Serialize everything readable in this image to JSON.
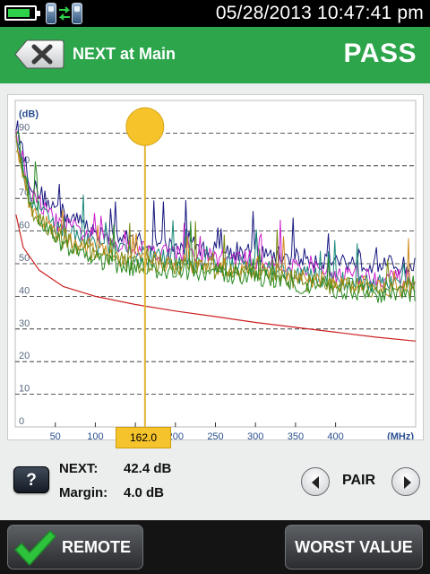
{
  "status_bar": {
    "datetime": "05/28/2013 10:47:41 pm",
    "icons": [
      "battery-icon",
      "tester-device-icon",
      "link-arrows-icon",
      "remote-device-icon"
    ],
    "battery_level": 0.85
  },
  "header": {
    "title": "NEXT at Main",
    "result": "PASS",
    "back_icon": "close-x-icon",
    "background_color": "#2ca54b"
  },
  "chart_data": {
    "type": "line",
    "xlabel": "(MHz)",
    "ylabel": "(dB)",
    "xlim": [
      0,
      500
    ],
    "ylim": [
      0,
      100
    ],
    "x_ticks": [
      "50",
      "100",
      "150",
      "200",
      "250",
      "300",
      "350",
      "400"
    ],
    "y_ticks": [
      "0",
      "10",
      "20",
      "30",
      "40",
      "50",
      "60",
      "70",
      "80",
      "90"
    ],
    "grid": true,
    "cursor_x": 162.0,
    "limit_line": {
      "color": "#cc2020",
      "points": [
        [
          1,
          65
        ],
        [
          10,
          55
        ],
        [
          30,
          48
        ],
        [
          60,
          43
        ],
        [
          100,
          40
        ],
        [
          150,
          37.5
        ],
        [
          200,
          35.5
        ],
        [
          250,
          33.8
        ],
        [
          300,
          32
        ],
        [
          350,
          30.5
        ],
        [
          400,
          29
        ],
        [
          450,
          27.5
        ],
        [
          500,
          26.3
        ]
      ]
    },
    "series": [
      {
        "color": "#1a1a80",
        "base": [
          [
            1,
            93
          ],
          [
            20,
            74
          ],
          [
            50,
            67
          ],
          [
            100,
            60
          ],
          [
            150,
            57
          ],
          [
            200,
            55
          ],
          [
            250,
            54
          ],
          [
            300,
            53
          ],
          [
            350,
            52
          ],
          [
            400,
            51
          ],
          [
            500,
            49
          ]
        ]
      },
      {
        "color": "#cc22cc",
        "base": [
          [
            1,
            90
          ],
          [
            20,
            71
          ],
          [
            50,
            63
          ],
          [
            100,
            58
          ],
          [
            150,
            55
          ],
          [
            200,
            53
          ],
          [
            250,
            52
          ],
          [
            300,
            51
          ],
          [
            350,
            49
          ],
          [
            400,
            47
          ],
          [
            500,
            45
          ]
        ]
      },
      {
        "color": "#1a8a7a",
        "base": [
          [
            1,
            88
          ],
          [
            20,
            69
          ],
          [
            50,
            61
          ],
          [
            100,
            56
          ],
          [
            150,
            53
          ],
          [
            200,
            51
          ],
          [
            250,
            50
          ],
          [
            300,
            49
          ],
          [
            350,
            47
          ],
          [
            400,
            45
          ],
          [
            500,
            43
          ]
        ]
      },
      {
        "color": "#d08a1c",
        "base": [
          [
            1,
            86
          ],
          [
            20,
            67
          ],
          [
            50,
            59
          ],
          [
            100,
            54
          ],
          [
            150,
            51
          ],
          [
            200,
            50
          ],
          [
            250,
            49
          ],
          [
            300,
            48
          ],
          [
            350,
            46
          ],
          [
            400,
            44
          ],
          [
            500,
            42
          ]
        ]
      },
      {
        "color": "#7a8a10",
        "base": [
          [
            1,
            87
          ],
          [
            20,
            67
          ],
          [
            50,
            58
          ],
          [
            100,
            53
          ],
          [
            150,
            50
          ],
          [
            200,
            49
          ],
          [
            250,
            48
          ],
          [
            300,
            47
          ],
          [
            350,
            45
          ],
          [
            400,
            43
          ],
          [
            500,
            42
          ]
        ]
      },
      {
        "color": "#2a8a22",
        "base": [
          [
            1,
            91
          ],
          [
            20,
            68
          ],
          [
            50,
            57
          ],
          [
            100,
            51
          ],
          [
            150,
            49
          ],
          [
            200,
            48
          ],
          [
            250,
            47
          ],
          [
            300,
            46
          ],
          [
            350,
            44
          ],
          [
            400,
            42
          ],
          [
            500,
            40
          ]
        ]
      }
    ]
  },
  "cursor": {
    "value": "162.0"
  },
  "measurements": {
    "next_label": "NEXT:",
    "next_value": "42.4 dB",
    "margin_label": "Margin:",
    "margin_value": "4.0 dB"
  },
  "help": {
    "label": "?"
  },
  "pair": {
    "label": "PAIR",
    "prev_icon": "chevron-left-icon",
    "next_icon": "chevron-right-icon"
  },
  "footer": {
    "remote_label": "REMOTE",
    "remote_icon": "checkmark-icon",
    "worst_value_label": "WORST VALUE"
  }
}
